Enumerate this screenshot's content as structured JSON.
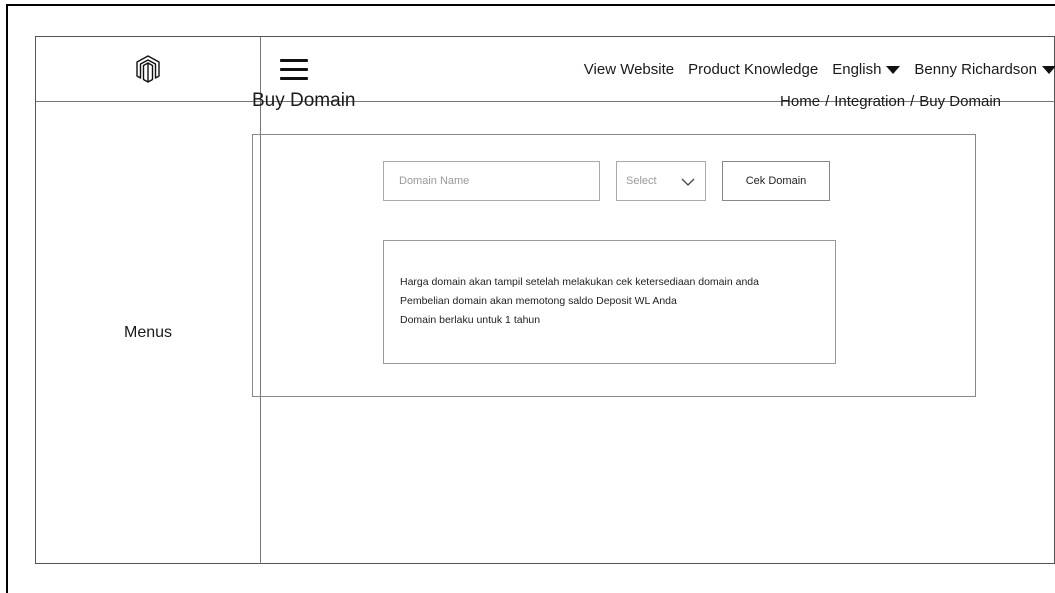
{
  "header": {
    "nav_links": {
      "view_website": "View Website",
      "product_knowledge": "Product Knowledge",
      "language": "English",
      "user": "Benny Richardson"
    }
  },
  "sidebar": {
    "label": "Menus"
  },
  "page": {
    "title": "Buy Domain",
    "breadcrumb": [
      "Home",
      "Integration",
      "Buy Domain"
    ],
    "breadcrumb_separator": "/"
  },
  "form": {
    "domain_placeholder": "Domain Name",
    "domain_value": "",
    "tld_select_value": "Select",
    "cek_button_label": "Cek Domain"
  },
  "info": {
    "lines": [
      "Harga domain akan tampil setelah melakukan cek ketersediaan domain anda",
      "Pembelian domain akan memotong saldo Deposit WL Anda",
      "Domain berlaku untuk 1 tahun"
    ]
  },
  "icons": {
    "logo": "magento-logo-icon",
    "menu": "hamburger-icon",
    "dropdown": "caret-down-icon",
    "select_chevron": "chevron-down-icon"
  }
}
